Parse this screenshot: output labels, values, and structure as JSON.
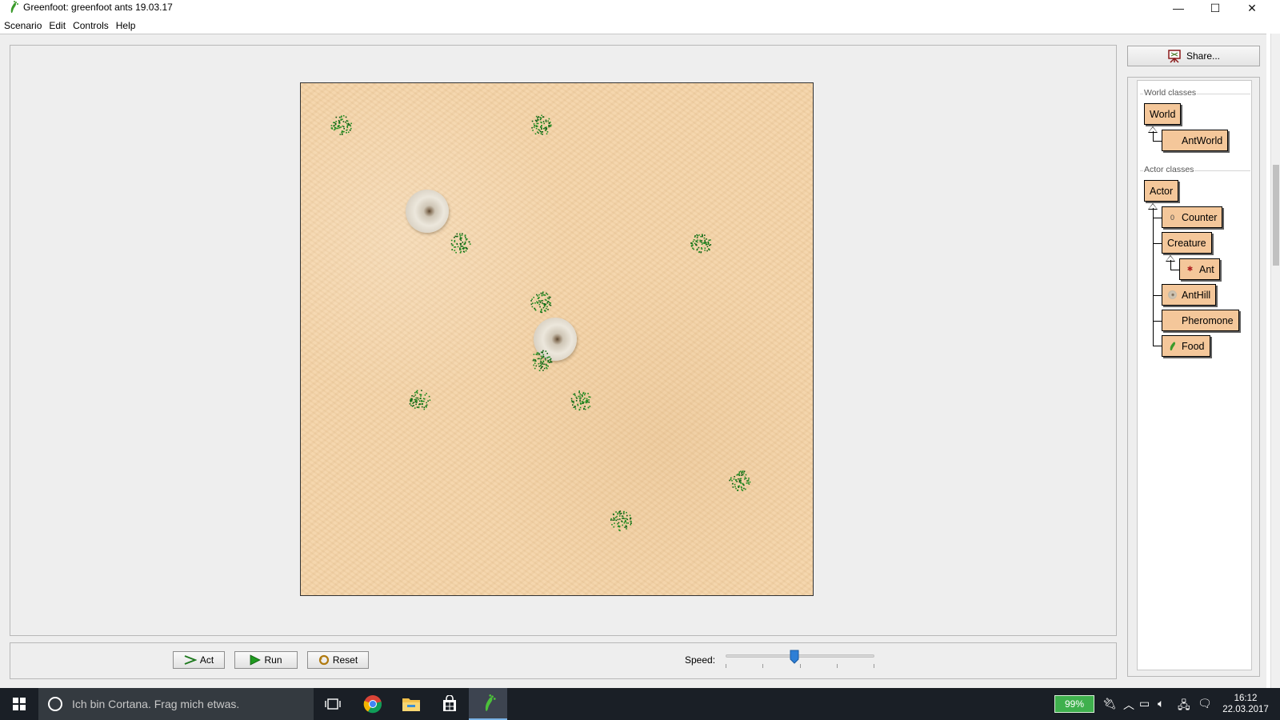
{
  "window": {
    "title": "Greenfoot: greenfoot ants 19.03.17",
    "minimize": "—",
    "maximize": "☐",
    "close": "✕"
  },
  "menu": [
    "Scenario",
    "Edit",
    "Controls",
    "Help"
  ],
  "controls": {
    "act_label": "Act",
    "run_label": "Run",
    "reset_label": "Reset",
    "speed_label": "Speed:",
    "speed_fraction": 0.46
  },
  "share_label": "Share...",
  "world_classes": {
    "title": "World classes",
    "root": "World",
    "children": [
      "AntWorld"
    ]
  },
  "actor_classes": {
    "title": "Actor classes",
    "root": "Actor",
    "children": [
      "Counter",
      "Creature",
      "Ant",
      "AntHill",
      "Pheromone",
      "Food"
    ]
  },
  "taskbar": {
    "search_placeholder": "Ich bin Cortana. Frag mich etwas.",
    "battery": "99%",
    "time": "16:12",
    "date": "22.03.2017"
  },
  "colors": {
    "sand": "#f3d3a8",
    "class_box": "#f4c79a",
    "food_green": "#1f8a1f",
    "taskbar": "#1a1f26",
    "battery": "#3fb04d"
  }
}
